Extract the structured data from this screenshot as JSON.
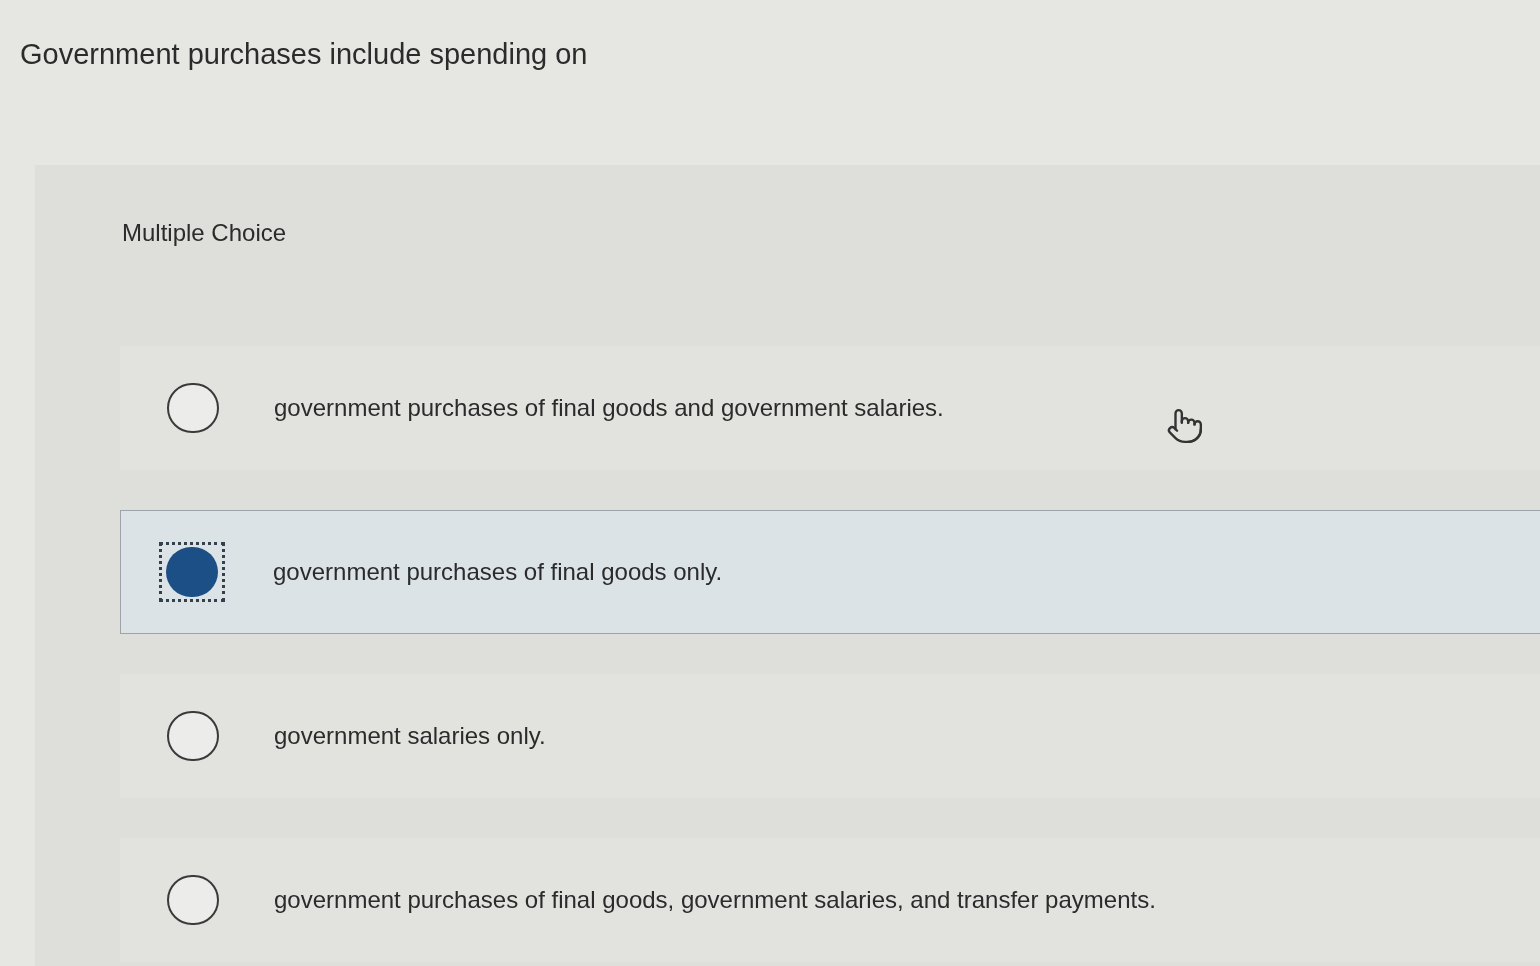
{
  "question": {
    "text": "Government purchases include spending on"
  },
  "panel": {
    "label": "Multiple Choice"
  },
  "options": [
    {
      "text": "government purchases of final goods and government salaries.",
      "selected": false
    },
    {
      "text": "government purchases of final goods only.",
      "selected": true
    },
    {
      "text": "government salaries only.",
      "selected": false
    },
    {
      "text": "government purchases of final goods, government salaries, and transfer payments.",
      "selected": false
    }
  ]
}
